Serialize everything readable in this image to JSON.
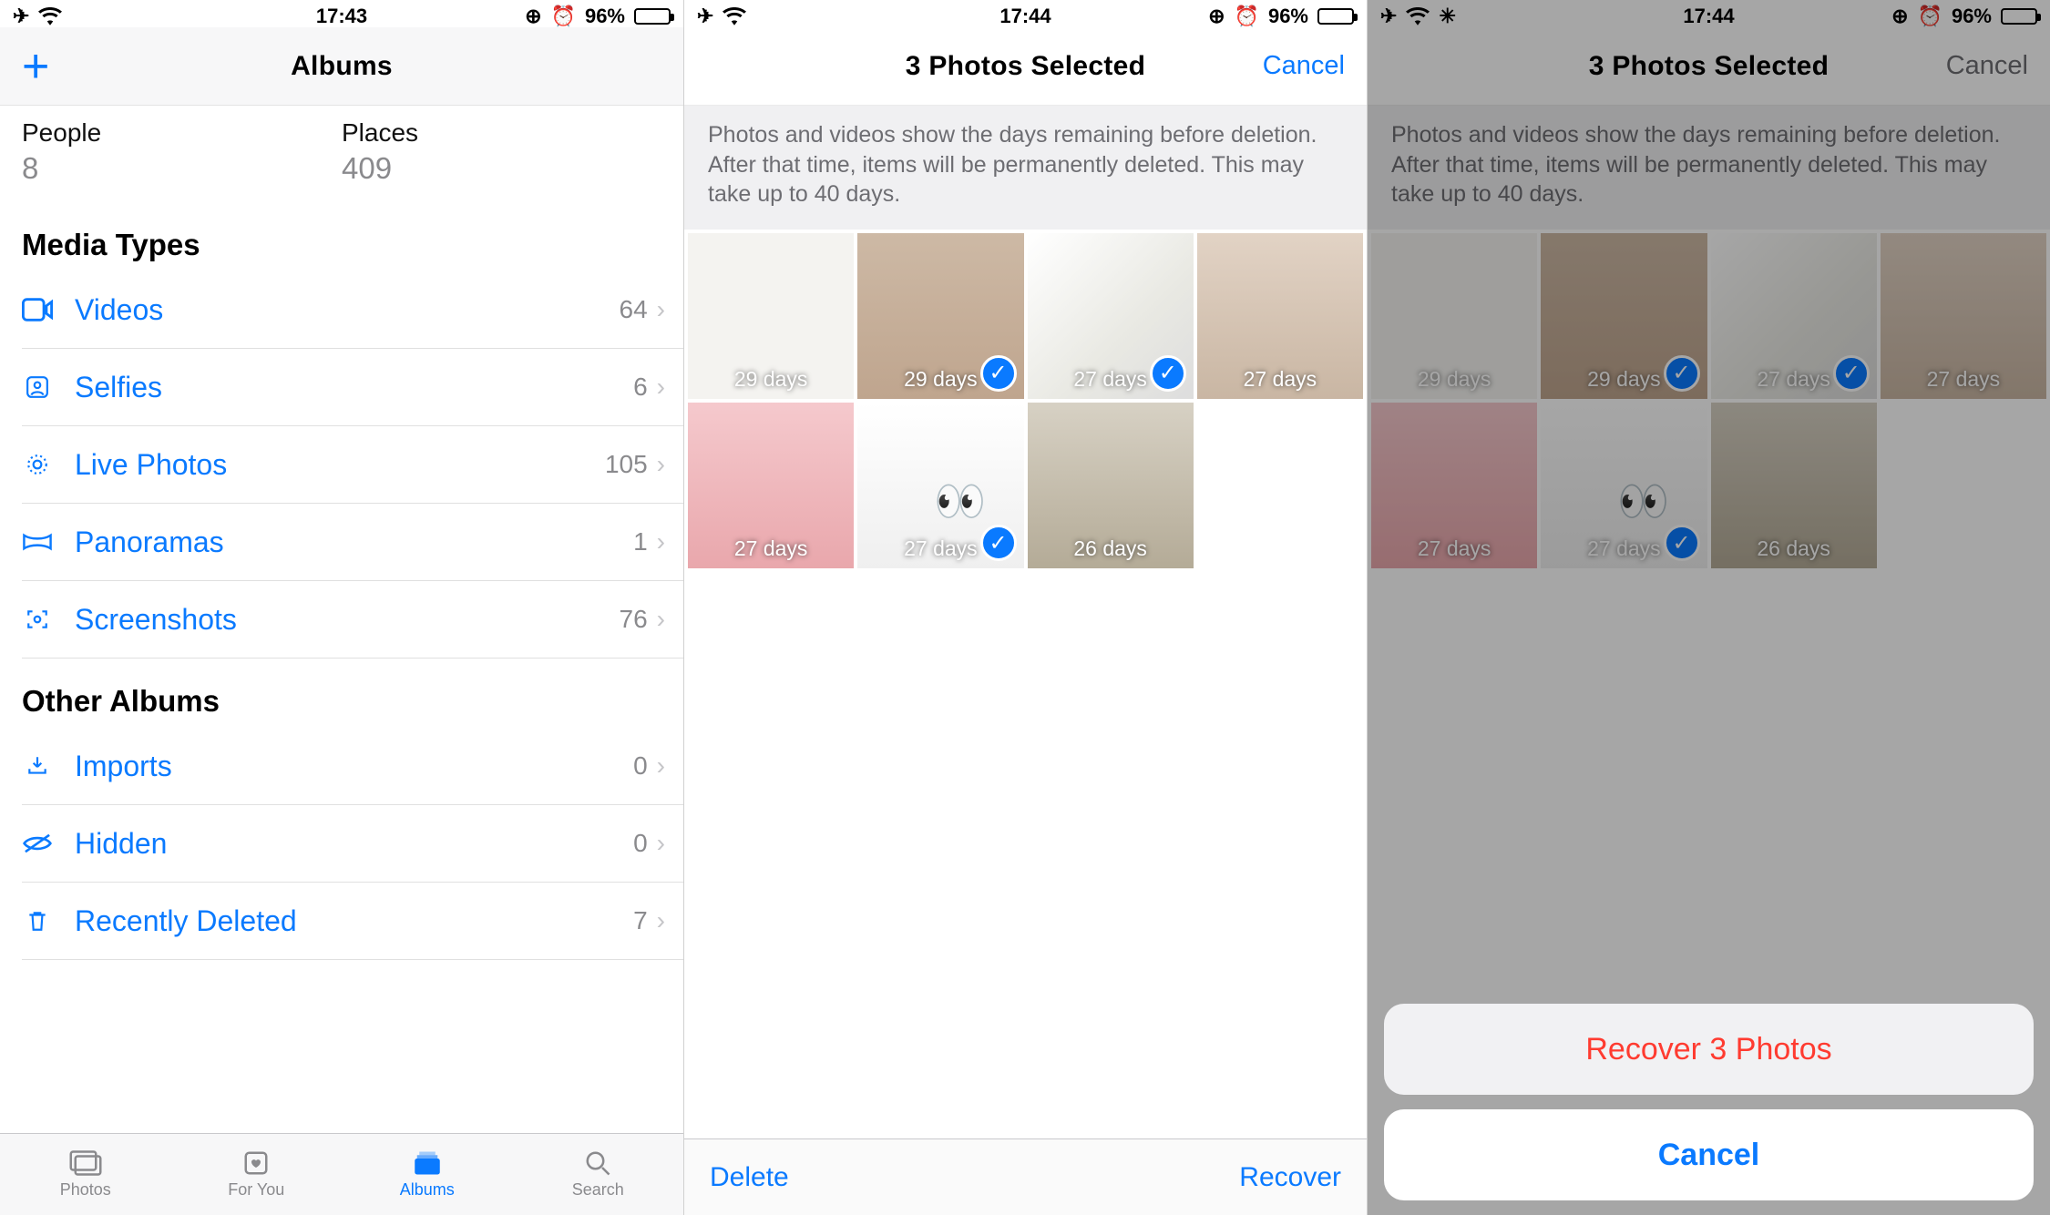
{
  "status": {
    "time1": "17:43",
    "time2": "17:44",
    "time3": "17:44",
    "battery_pct": "96%"
  },
  "pane1": {
    "nav_title": "Albums",
    "people_label": "People",
    "people_count": "8",
    "places_label": "Places",
    "places_count": "409",
    "section_media": "Media Types",
    "section_other": "Other Albums",
    "media_rows": [
      {
        "label": "Videos",
        "count": "64"
      },
      {
        "label": "Selfies",
        "count": "6"
      },
      {
        "label": "Live Photos",
        "count": "105"
      },
      {
        "label": "Panoramas",
        "count": "1"
      },
      {
        "label": "Screenshots",
        "count": "76"
      }
    ],
    "other_rows": [
      {
        "label": "Imports",
        "count": "0"
      },
      {
        "label": "Hidden",
        "count": "0"
      },
      {
        "label": "Recently Deleted",
        "count": "7"
      }
    ],
    "tabs": {
      "photos": "Photos",
      "foryou": "For You",
      "albums": "Albums",
      "search": "Search"
    }
  },
  "note_text": "Photos and videos show the days remaining before deletion. After that time, items will be permanently deleted. This may take up to 40 days.",
  "sel_title": "3 Photos Selected",
  "cancel_label": "Cancel",
  "thumbs": [
    {
      "days": "29 days",
      "sel": false,
      "cls": "doc"
    },
    {
      "days": "29 days",
      "sel": true,
      "cls": "person1"
    },
    {
      "days": "27 days",
      "sel": true,
      "cls": "pillow"
    },
    {
      "days": "27 days",
      "sel": false,
      "cls": "person2"
    },
    {
      "days": "27 days",
      "sel": false,
      "cls": "pink"
    },
    {
      "days": "27 days",
      "sel": true,
      "cls": "paper"
    },
    {
      "days": "26 days",
      "sel": false,
      "cls": "room"
    }
  ],
  "toolbar": {
    "delete": "Delete",
    "recover": "Recover"
  },
  "sheet": {
    "recover": "Recover 3 Photos",
    "cancel": "Cancel"
  }
}
